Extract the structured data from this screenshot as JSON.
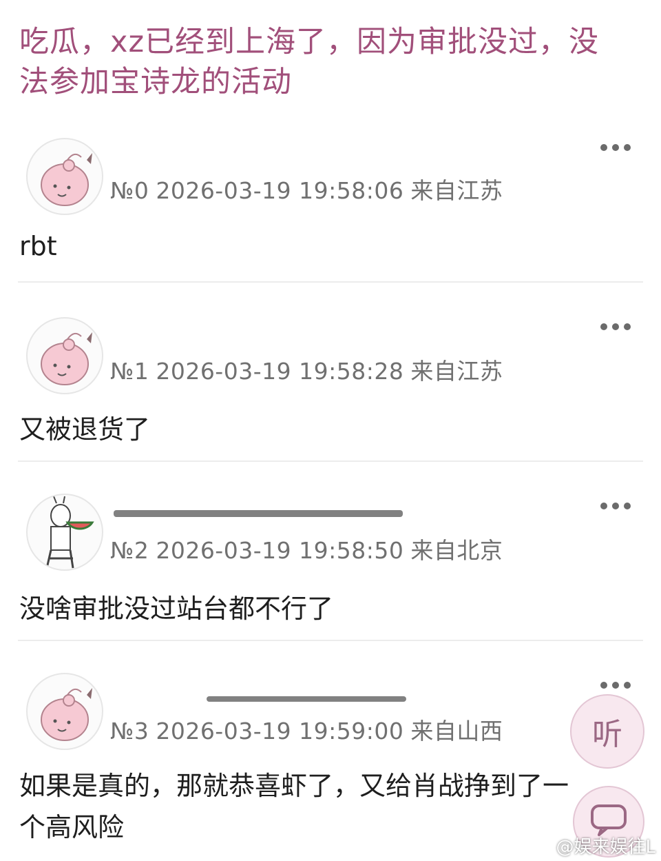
{
  "title": "吃瓜，xz已经到上海了，因为审批没过，没法参加宝诗龙的活动",
  "posts": [
    {
      "num": "№0",
      "timestamp": "2026-03-19 19:58:06",
      "location": "来自江苏",
      "content": "rbt",
      "avatar": "pink-creature"
    },
    {
      "num": "№1",
      "timestamp": "2026-03-19 19:58:28",
      "location": "来自江苏",
      "content": "又被退货了",
      "avatar": "pink-creature"
    },
    {
      "num": "№2",
      "timestamp": "2026-03-19 19:58:50",
      "location": "来自北京",
      "content": "没啥审批没过站台都不行了",
      "avatar": "rabbit-watermelon"
    },
    {
      "num": "№3",
      "timestamp": "2026-03-19 19:59:00",
      "location": "来自山西",
      "content": "如果是真的，那就恭喜虾了，又给肖战挣到了一个高风险",
      "avatar": "pink-creature"
    }
  ],
  "post3_content_line2": "个高风险",
  "post3_content_line1": "如果是真的，那就恭喜虾了，又给肖战挣到了一",
  "float_buttons": {
    "listen_label": "听"
  },
  "icons": {
    "more": "more-icon",
    "comment": "comment-bubble-icon"
  },
  "watermark": "@娱来娱往L",
  "colors": {
    "title": "#a14f7a",
    "meta": "#707070",
    "fab_bg": "#f7e6ee"
  }
}
